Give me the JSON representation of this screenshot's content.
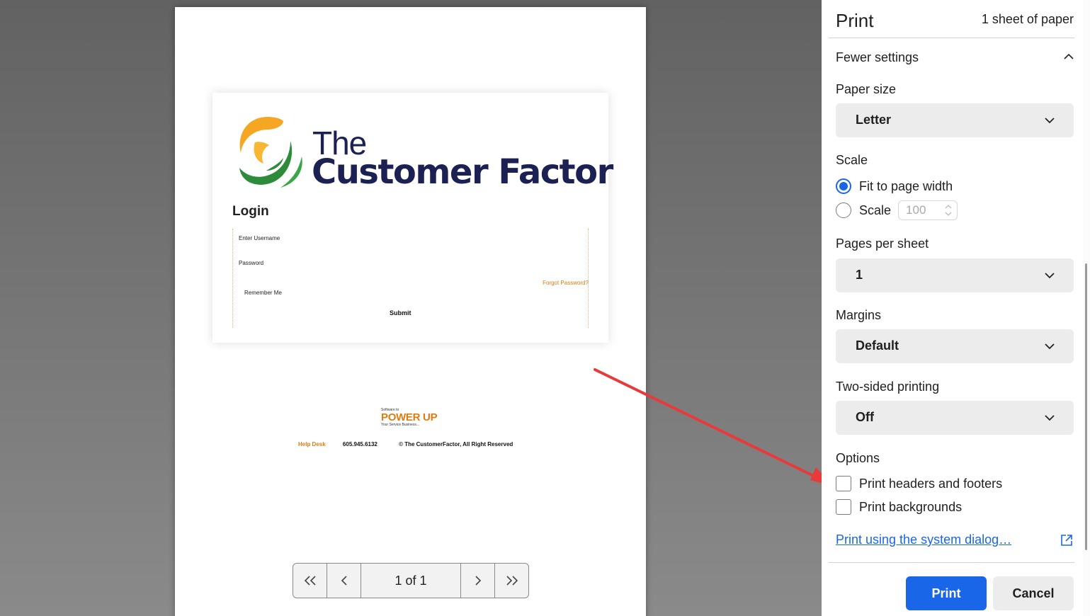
{
  "preview": {
    "logo": {
      "line1": "The",
      "line2": "Customer Factor"
    },
    "login": {
      "heading": "Login",
      "username_label": "Enter Username",
      "password_label": "Password",
      "forgot_password": "Forgot Password?",
      "remember_me": "Remember Me",
      "submit": "Submit"
    },
    "powerup": {
      "top": "Software to",
      "main": "POWER UP",
      "sub": "Your Service Business..."
    },
    "footer": {
      "help_desk": "Help Desk",
      "phone": "605.945.6132",
      "copyright": "© The CustomerFactor, All Right Reserved"
    },
    "page_nav": {
      "indicator": "1 of 1"
    }
  },
  "panel": {
    "title": "Print",
    "sheet_count": "1 sheet of paper",
    "fewer_settings": "Fewer settings",
    "paper_size": {
      "label": "Paper size",
      "value": "Letter"
    },
    "scale": {
      "label": "Scale",
      "option_fit": "Fit to page width",
      "option_scale": "Scale",
      "scale_value": "100",
      "selected": "fit"
    },
    "pages_per_sheet": {
      "label": "Pages per sheet",
      "value": "1"
    },
    "margins": {
      "label": "Margins",
      "value": "Default"
    },
    "two_sided": {
      "label": "Two-sided printing",
      "value": "Off"
    },
    "options": {
      "label": "Options",
      "headers_footers": "Print headers and footers",
      "backgrounds": "Print backgrounds"
    },
    "system_dialog_link": "Print using the system dialog…",
    "print_button": "Print",
    "cancel_button": "Cancel"
  },
  "colors": {
    "accent": "#1a66e8",
    "logo_navy": "#1c2153",
    "orange": "#e07b12",
    "annotation_arrow": "#e8393b"
  }
}
